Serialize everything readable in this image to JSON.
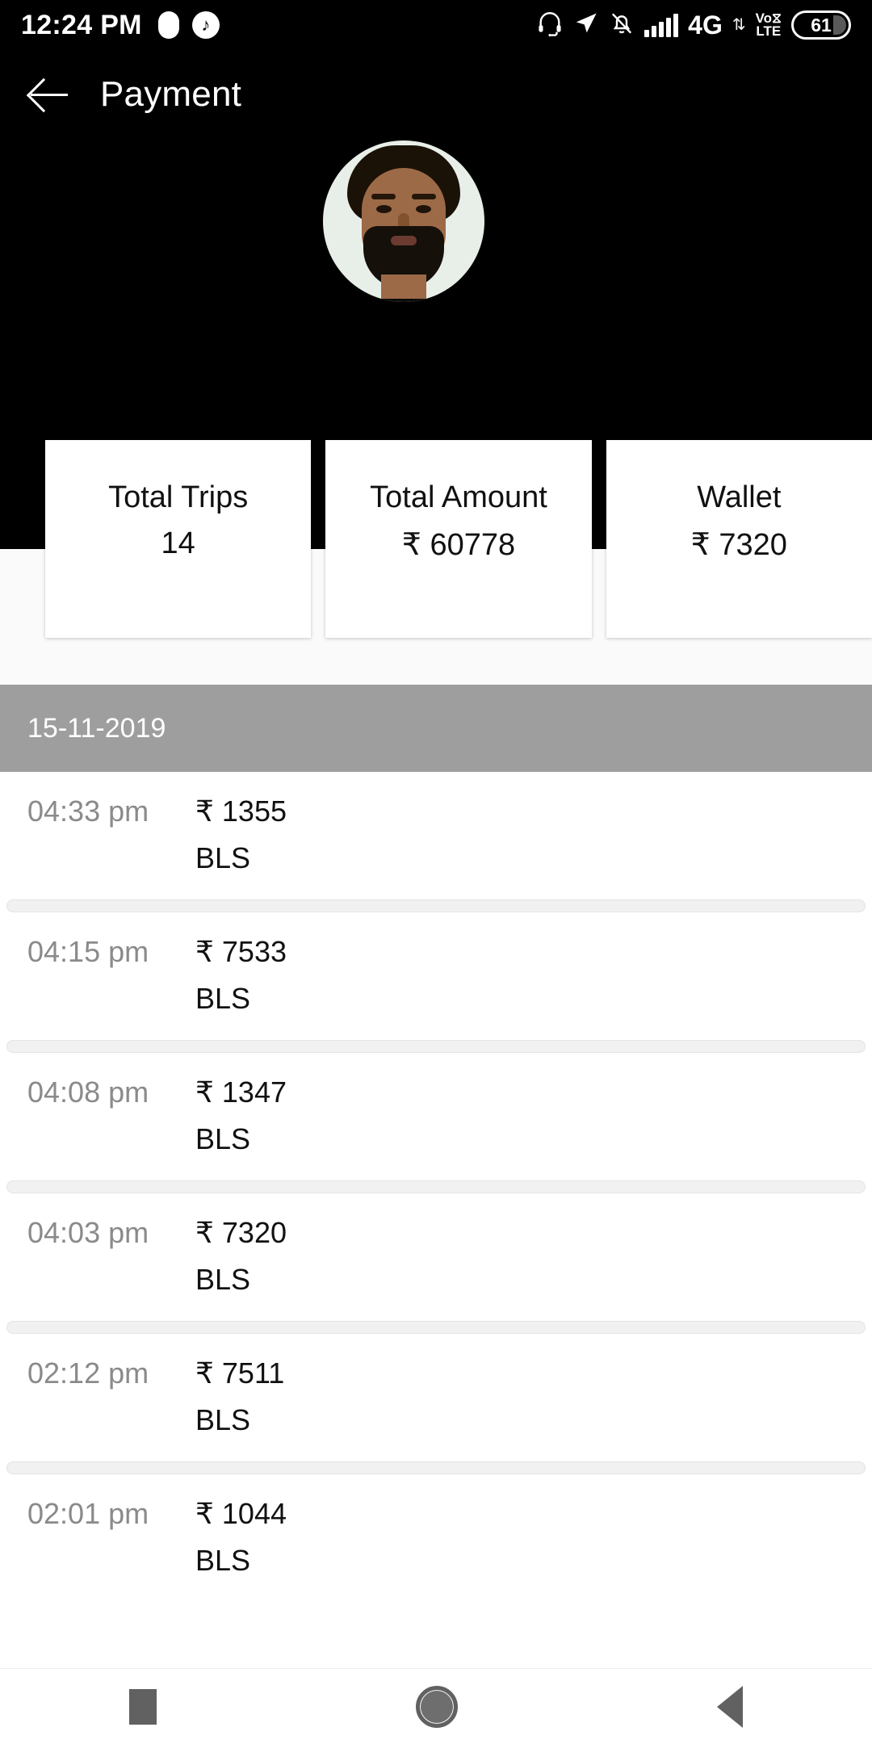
{
  "statusbar": {
    "clock": "12:24 PM",
    "left_icons": [
      "pill-indicator-icon",
      "music-note-icon"
    ],
    "music_glyph": "♪",
    "right_icons": [
      "headset-icon",
      "location-arrow-icon",
      "bell-muted-icon",
      "signal-bars-icon",
      "data-arrows-icon",
      "volte-icon",
      "battery-icon"
    ],
    "network": "4G",
    "data_arrows": "⇅",
    "volte_top": "Vo⧖",
    "volte_bottom": "LTE",
    "battery_level": "61"
  },
  "appbar": {
    "back_icon": "back-arrow-icon",
    "title": "Payment"
  },
  "profile": {
    "avatar_alt": "user-avatar"
  },
  "stats": [
    {
      "label": "Total Trips",
      "value": "14"
    },
    {
      "label": "Total Amount",
      "value": "₹ 60778"
    },
    {
      "label": "Wallet",
      "value": "₹ 7320"
    }
  ],
  "transactions": {
    "date_header": "15-11-2019",
    "rows": [
      {
        "time": "04:33 pm",
        "amount": "₹ 1355",
        "type": "BLS"
      },
      {
        "time": "04:15 pm",
        "amount": "₹ 7533",
        "type": "BLS"
      },
      {
        "time": "04:08 pm",
        "amount": "₹ 1347",
        "type": "BLS"
      },
      {
        "time": "04:03 pm",
        "amount": "₹ 7320",
        "type": "BLS"
      },
      {
        "time": "02:12 pm",
        "amount": "₹ 7511",
        "type": "BLS"
      },
      {
        "time": "02:01 pm",
        "amount": "₹ 1044",
        "type": "BLS"
      }
    ]
  },
  "navbar": {
    "items": [
      "recents-square-icon",
      "home-circle-icon",
      "back-triangle-icon"
    ]
  },
  "colors": {
    "header_bg": "#000000",
    "date_header_bg": "#9e9e9e",
    "card_bg": "#ffffff",
    "time_text": "#8a8a8a",
    "body_text": "#111111",
    "page_bg": "#fafafa",
    "nav_icon": "#616161"
  }
}
